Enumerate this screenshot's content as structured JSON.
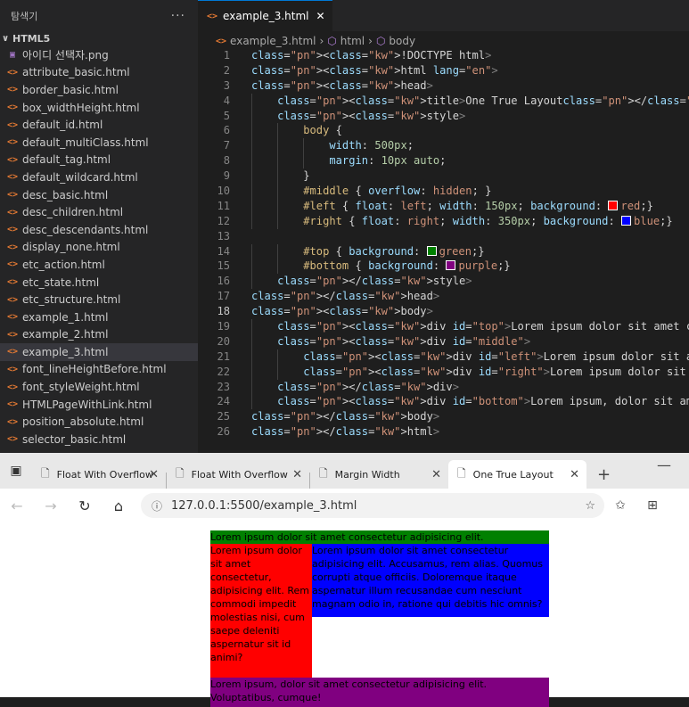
{
  "sidebar": {
    "title": "탐색기",
    "more": "···",
    "section": "HTML5",
    "files": [
      {
        "name": "아이디 선택자.png",
        "type": "png"
      },
      {
        "name": "attribute_basic.html",
        "type": "html"
      },
      {
        "name": "border_basic.html",
        "type": "html"
      },
      {
        "name": "box_widthHeight.html",
        "type": "html"
      },
      {
        "name": "default_id.html",
        "type": "html"
      },
      {
        "name": "default_multiClass.html",
        "type": "html"
      },
      {
        "name": "default_tag.html",
        "type": "html"
      },
      {
        "name": "default_wildcard.html",
        "type": "html"
      },
      {
        "name": "desc_basic.html",
        "type": "html"
      },
      {
        "name": "desc_children.html",
        "type": "html"
      },
      {
        "name": "desc_descendants.html",
        "type": "html"
      },
      {
        "name": "display_none.html",
        "type": "html"
      },
      {
        "name": "etc_action.html",
        "type": "html"
      },
      {
        "name": "etc_state.html",
        "type": "html"
      },
      {
        "name": "etc_structure.html",
        "type": "html"
      },
      {
        "name": "example_1.html",
        "type": "html"
      },
      {
        "name": "example_2.html",
        "type": "html"
      },
      {
        "name": "example_3.html",
        "type": "html",
        "active": true
      },
      {
        "name": "font_lineHeightBefore.html",
        "type": "html"
      },
      {
        "name": "font_styleWeight.html",
        "type": "html"
      },
      {
        "name": "HTMLPageWithLink.html",
        "type": "html"
      },
      {
        "name": "position_absolute.html",
        "type": "html"
      },
      {
        "name": "selector_basic.html",
        "type": "html"
      }
    ]
  },
  "editor": {
    "tab": "example_3.html",
    "breadcrumb": [
      "example_3.html",
      "html",
      "body"
    ],
    "current_line": 18,
    "lines": [
      "<!DOCTYPE html>",
      "<html lang=\"en\">",
      "<head>",
      "    <title>One True Layout</title>",
      "    <style>",
      "        body {",
      "            width: 500px;",
      "            margin: 10px auto;",
      "        }",
      "        #middle { overflow: hidden; }",
      "        #left { float: left; width: 150px; background: red;}",
      "        #right { float: right; width: 350px; background: blue;}",
      "",
      "        #top { background: green;}",
      "        #bottom { background: purple;}",
      "    </style>",
      "</head>",
      "<body>",
      "    <div id=\"top\">Lorem ipsum dolor sit amet consectetur adipisicing elit.</div>",
      "    <div id=\"middle\">",
      "        <div id=\"left\">Lorem ipsum dolor sit amet consectetur, adipisicing elit",
      "        <div id=\"right\">Lorem ipsum dolor sit amet consectetur adipisicing elit",
      "    </div>",
      "    <div id=\"bottom\">Lorem ipsum, dolor sit amet consectetur adipisicing elit.",
      "</body>",
      "</html>"
    ],
    "swatches": {
      "red": "#ff0000",
      "blue": "#0000ff",
      "green": "#008000",
      "purple": "#800080"
    }
  },
  "browser": {
    "tabs": [
      {
        "title": "Float With Overflow",
        "active": false
      },
      {
        "title": "Float With Overflow",
        "active": false
      },
      {
        "title": "Margin Width",
        "active": false
      },
      {
        "title": "One True Layout",
        "active": true
      }
    ],
    "url": "127.0.0.1:5500/example_3.html",
    "page": {
      "top": "Lorem ipsum dolor sit amet consectetur adipisicing elit.",
      "left": "Lorem ipsum dolor sit amet consectetur, adipisicing elit. Rem commodi impedit molestias nisi, cum saepe deleniti aspernatur sit id animi?",
      "right": "Lorem ipsum dolor sit amet consectetur adipisicing elit. Accusamus, rem alias. Quomus corrupti atque officiis. Doloremque itaque aspernatur illum recusandae cum nesciunt magnam odio in, ratione qui debitis hic omnis?",
      "bottom": "Lorem ipsum, dolor sit amet consectetur adipisicing elit. Voluptatibus, cumque!"
    }
  }
}
